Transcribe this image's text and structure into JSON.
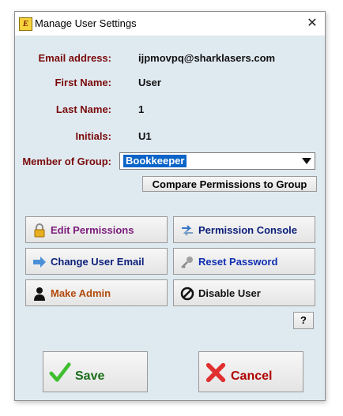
{
  "window": {
    "title": "Manage User Settings",
    "close_glyph": "✕",
    "app_icon_letter": "E"
  },
  "user": {
    "email_label": "Email address:",
    "email": "ijpmovpq@sharklasers.com",
    "first_name_label": "First Name:",
    "first_name": "User",
    "last_name_label": "Last Name:",
    "last_name": "1",
    "initials_label": "Initials:",
    "initials": "U1",
    "group_label": "Member of Group:",
    "group_value": "Bookkeeper"
  },
  "buttons": {
    "compare": "Compare Permissions to Group",
    "edit_permissions": "Edit Permissions",
    "permission_console": "Permission Console",
    "change_email": "Change User Email",
    "reset_password": "Reset Password",
    "make_admin": "Make Admin",
    "disable_user": "Disable User",
    "help": "?",
    "save": "Save",
    "cancel": "Cancel"
  },
  "colors": {
    "label": "#7a0b0b",
    "edit_permissions": "#7b1b7b",
    "permission_console": "#0b1f7a",
    "change_email": "#0b1f7a",
    "reset_password": "#1030b0",
    "make_admin": "#b34a0b",
    "disable_user": "#111111",
    "save": "#1a6e1a",
    "cancel": "#b00000"
  },
  "icons": {
    "edit_permissions": "lock-icon",
    "permission_console": "swap-arrows-icon",
    "change_email": "arrow-right-icon",
    "reset_password": "key-icon",
    "make_admin": "person-icon",
    "disable_user": "no-entry-icon",
    "save": "checkmark-icon",
    "cancel": "x-icon"
  }
}
